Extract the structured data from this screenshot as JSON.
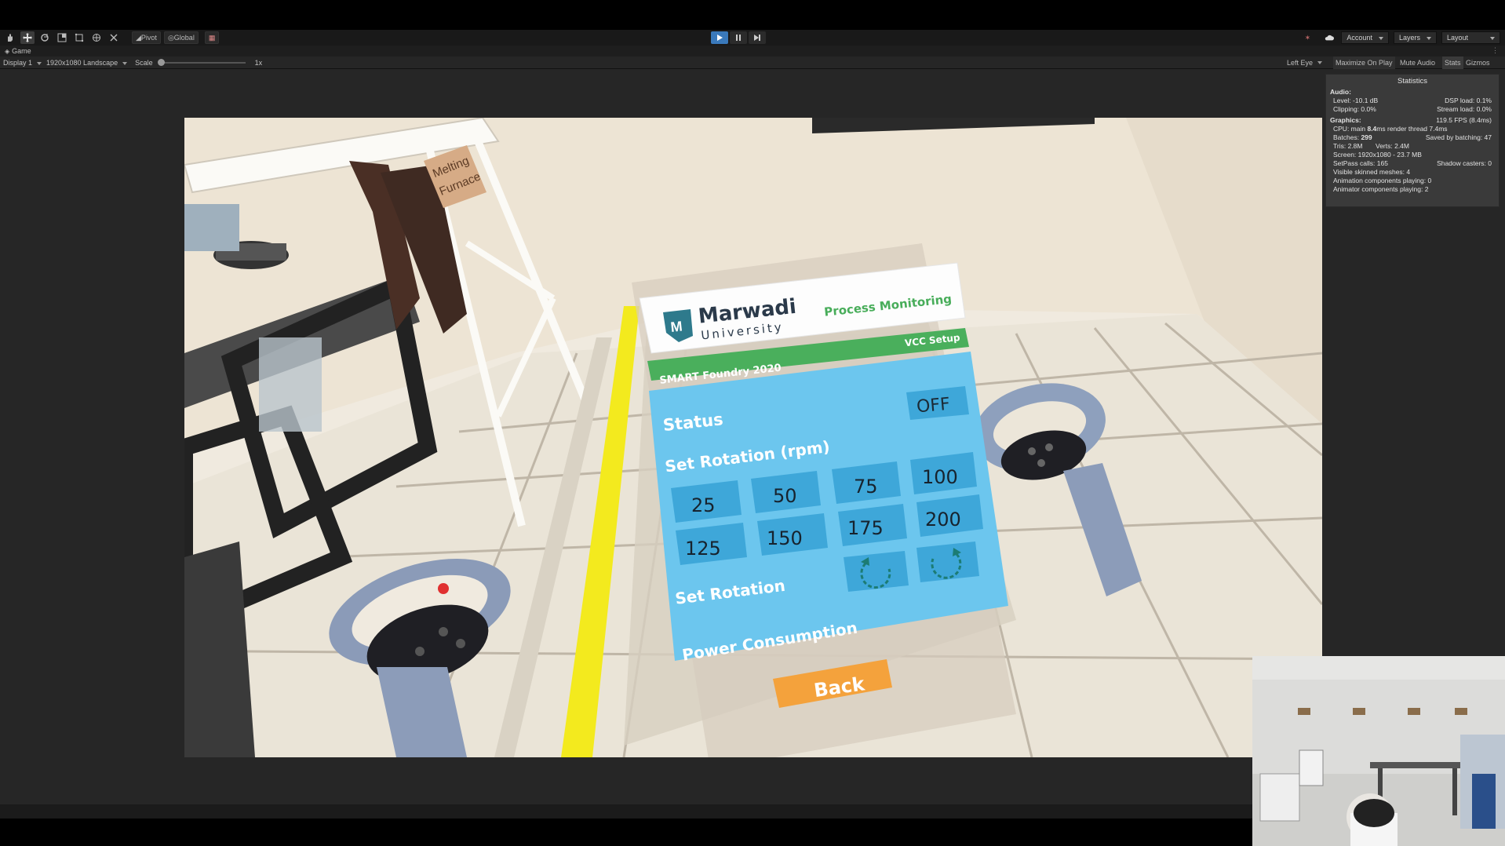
{
  "toolbar": {
    "tools": [
      "hand-tool",
      "move-tool",
      "rotate-tool",
      "scale-tool",
      "rect-tool",
      "transform-tool",
      "custom-tool"
    ],
    "pivot_label": "Pivot",
    "global_label": "Global",
    "account_label": "Account",
    "layers_label": "Layers",
    "layout_label": "Layout"
  },
  "tab": {
    "label": "Game"
  },
  "gamebar": {
    "display": "Display 1",
    "resolution": "1920x1080 Landscape",
    "scale_label": "Scale",
    "scale_value": "1x",
    "eye": "Left Eye",
    "maximize": "Maximize On Play",
    "mute": "Mute Audio",
    "stats": "Stats",
    "gizmos": "Gizmos"
  },
  "stats": {
    "title": "Statistics",
    "audio_header": "Audio:",
    "level": "Level: -10.1 dB",
    "dsp": "DSP load: 0.1%",
    "clipping": "Clipping: 0.0%",
    "stream": "Stream load: 0.0%",
    "graphics_header": "Graphics:",
    "fps": "119.5 FPS (8.4ms)",
    "cpu_prefix": "CPU: main ",
    "cpu_main": "8.4",
    "cpu_suffix": "ms  render thread 7.4ms",
    "batches_prefix": "Batches: ",
    "batches": "299",
    "saved": "Saved by batching: 47",
    "tris": "Tris: 2.8M",
    "verts": "Verts: 2.4M",
    "screen": "Screen: 1920x1080 - 23.7 MB",
    "setpass": "SetPass calls: 165",
    "shadow": "Shadow casters: 0",
    "skinned": "Visible skinned meshes: 4",
    "anim": "Animation components playing: 0",
    "animator": "Animator components playing: 2"
  },
  "scene": {
    "sign_line1": "Melting",
    "sign_line2": "Furnace"
  },
  "vr_panel": {
    "brand_name": "Marwadi",
    "brand_sub": "University",
    "header_title": "Process Monitoring",
    "banner_left": "SMART Foundry 2020",
    "banner_right": "VCC Setup",
    "status_label": "Status",
    "status_value": "OFF",
    "set_rotation_rpm_label": "Set Rotation (rpm)",
    "rpm_values": [
      "25",
      "50",
      "75",
      "100",
      "125",
      "150",
      "175",
      "200"
    ],
    "set_rotation_label": "Set Rotation",
    "power_label": "Power Consumption",
    "back_label": "Back"
  },
  "colors": {
    "panel_blue": "#6cc6ee",
    "button_blue": "#3ea7d9",
    "banner_green": "#4aaf5c",
    "back_orange": "#f4a23c",
    "play_active": "#3a79bb"
  }
}
